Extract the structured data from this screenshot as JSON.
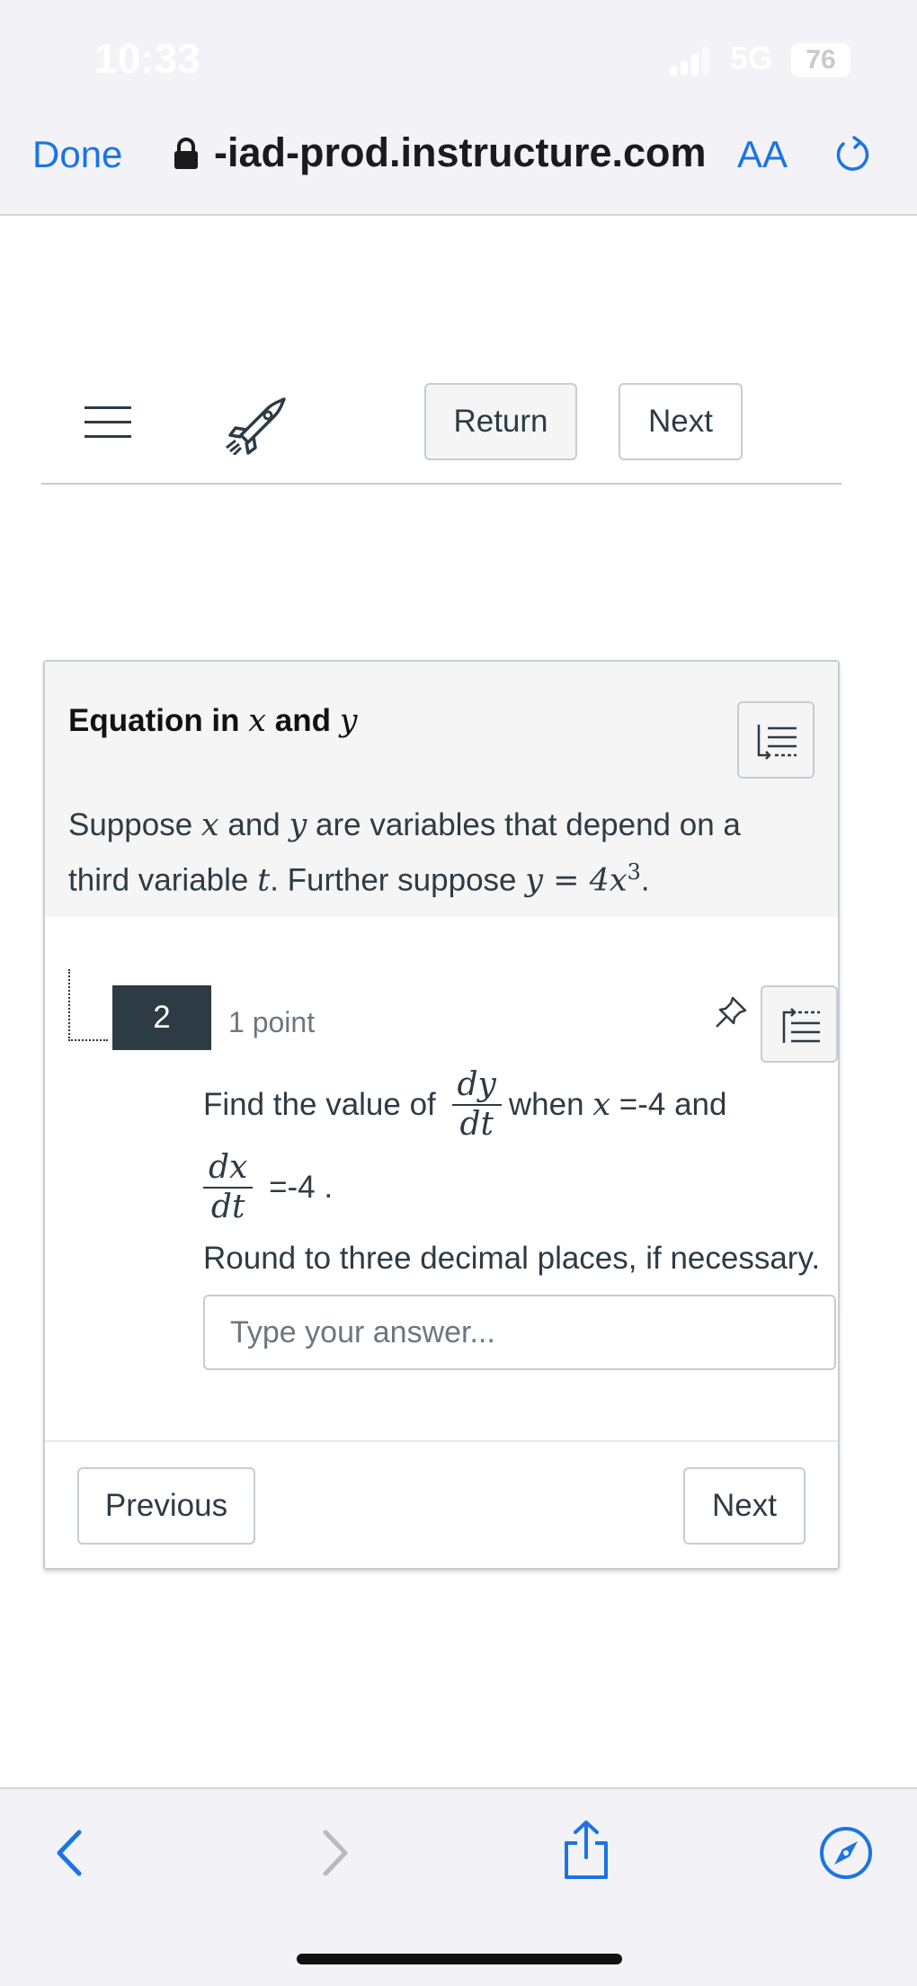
{
  "status_bar": {
    "time": "10:33",
    "network": "5G",
    "battery": "76"
  },
  "browser": {
    "done_label": "Done",
    "url": "-iad-prod.instructure.com",
    "text_size_label": "AA"
  },
  "nav": {
    "return_label": "Return",
    "next_label": "Next"
  },
  "stimulus": {
    "title_prefix": "Equation in ",
    "title_var1": "x",
    "title_and": " and ",
    "title_var2": "y",
    "text_1": "Suppose ",
    "var_x": "x",
    "text_2": " and ",
    "var_y": "y",
    "text_3": " are variables that depend on a",
    "text_4": "third variable ",
    "var_t": "t",
    "text_5": ". Further suppose ",
    "eq_lhs": "y",
    "eq_sign": " = ",
    "eq_rhs": "4x",
    "eq_exp": "3",
    "text_6": "."
  },
  "question": {
    "number": "2",
    "points": "1 point",
    "prefix": "Find the value of",
    "frac1_num": "dy",
    "frac1_den": "dt",
    "when": "when ",
    "var_x": "x",
    "eq1": " =-4 and",
    "frac2_num": "dx",
    "frac2_den": "dt",
    "eq2": " =-4 .",
    "round": "Round to three decimal places, if necessary.",
    "answer_placeholder": "Type your answer..."
  },
  "footer": {
    "previous_label": "Previous",
    "next_label": "Next"
  },
  "colors": {
    "link_blue": "#1a74e4",
    "dark_slate": "#2d3b45",
    "border": "#c7cdd1"
  }
}
